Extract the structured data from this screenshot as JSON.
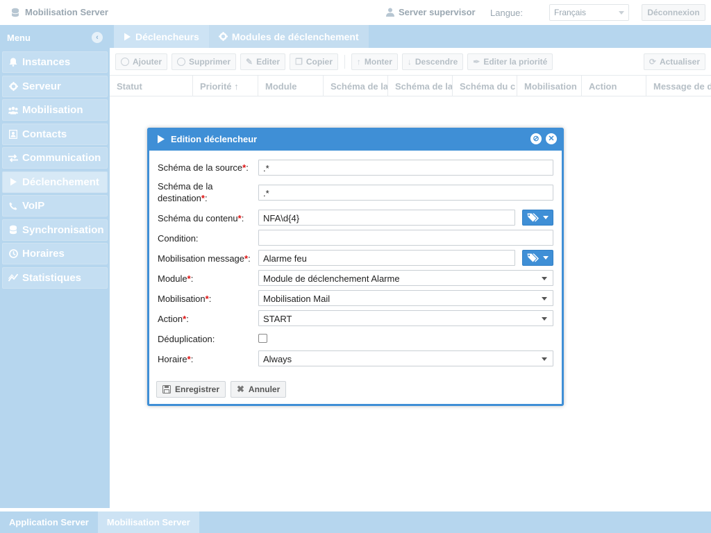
{
  "header": {
    "app_title": "Mobilisation Server",
    "supervisor": "Server supervisor",
    "language_label": "Langue:",
    "language_value": "Français",
    "logout_label": "Déconnexion"
  },
  "sidebar": {
    "title": "Menu",
    "items": [
      {
        "label": "Instances",
        "icon": "bell-icon"
      },
      {
        "label": "Serveur",
        "icon": "gear-icon"
      },
      {
        "label": "Mobilisation",
        "icon": "users-icon"
      },
      {
        "label": "Contacts",
        "icon": "address-book-icon"
      },
      {
        "label": "Communication",
        "icon": "exchange-icon"
      },
      {
        "label": "Déclenchement",
        "icon": "play-icon"
      },
      {
        "label": "VoIP",
        "icon": "phone-icon"
      },
      {
        "label": "Synchronisation",
        "icon": "database-icon"
      },
      {
        "label": "Horaires",
        "icon": "clock-icon"
      },
      {
        "label": "Statistiques",
        "icon": "chart-icon"
      }
    ]
  },
  "tabs": [
    {
      "label": "Déclencheurs"
    },
    {
      "label": "Modules de déclenchement"
    }
  ],
  "toolbar": {
    "add": "Ajouter",
    "delete": "Supprimer",
    "edit": "Editer",
    "copy": "Copier",
    "up": "Monter",
    "down": "Descendre",
    "edit_priority": "Editer la priorité",
    "refresh": "Actualiser"
  },
  "table": {
    "columns": [
      "Statut",
      "Priorité",
      "Module",
      "Schéma de la",
      "Schéma de la",
      "Schéma du c",
      "Mobilisation",
      "Action",
      "Message de d"
    ]
  },
  "dialog": {
    "title": "Edition déclencheur",
    "fields": {
      "source_label": "Schéma de la source",
      "source_value": ".*",
      "dest_label_1": "Schéma de la",
      "dest_label_2": "destination",
      "dest_value": ".*",
      "content_label": "Schéma du contenu",
      "content_value": "NFA\\d{4}",
      "condition_label": "Condition:",
      "condition_value": "",
      "message_label": "Mobilisation message",
      "message_value": "Alarme feu",
      "module_label": "Module",
      "module_value": "Module de déclenchement Alarme",
      "mobilisation_label": "Mobilisation",
      "mobilisation_value": "Mobilisation Mail",
      "action_label": "Action",
      "action_value": "START",
      "dedup_label": "Déduplication:",
      "schedule_label": "Horaire",
      "schedule_value": "Always"
    },
    "save_label": "Enregistrer",
    "cancel_label": "Annuler"
  },
  "bottom_tabs": [
    "Application Server",
    "Mobilisation Server"
  ]
}
